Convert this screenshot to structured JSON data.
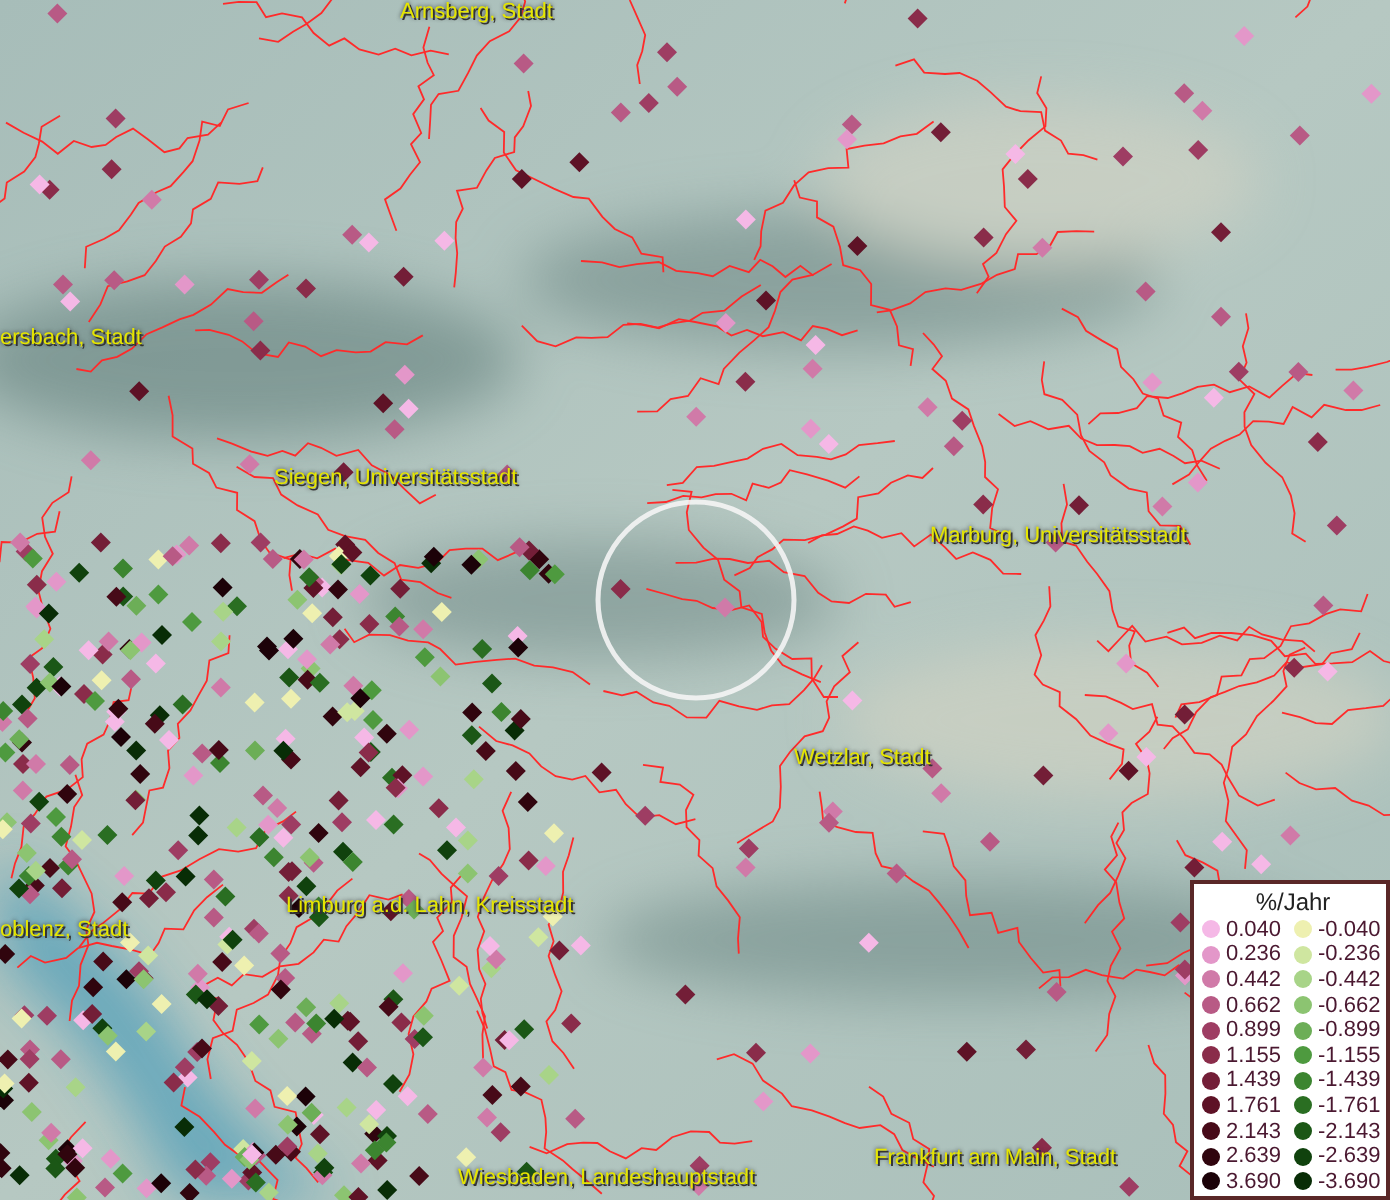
{
  "map": {
    "place_labels": [
      {
        "text": "Arnsberg, Stadt"
      },
      {
        "text": "ersbach, Stadt"
      },
      {
        "text": "Siegen, Universitätsstadt"
      },
      {
        "text": "Marburg, Universitätsstadt"
      },
      {
        "text": "Wetzlar, Stadt"
      },
      {
        "text": "Limburg a.d. Lahn, Kreisstadt"
      },
      {
        "text": "oblenz, Stadt"
      },
      {
        "text": "Frankfurt am Main, Stadt"
      },
      {
        "text": "Wiesbaden, Landeshauptstadt"
      }
    ]
  },
  "legend": {
    "title": "%/Jahr",
    "rows": [
      {
        "positive": {
          "value": "0.040",
          "color": "#f5b8e6"
        },
        "negative": {
          "value": "-0.040",
          "color": "#eef0b0"
        }
      },
      {
        "positive": {
          "value": "0.236",
          "color": "#e397c9"
        },
        "negative": {
          "value": "-0.236",
          "color": "#cfe6a0"
        }
      },
      {
        "positive": {
          "value": "0.442",
          "color": "#d07aa8"
        },
        "negative": {
          "value": "-0.442",
          "color": "#a8d488"
        }
      },
      {
        "positive": {
          "value": "0.662",
          "color": "#b85a85"
        },
        "negative": {
          "value": "-0.662",
          "color": "#8cc471"
        }
      },
      {
        "positive": {
          "value": "0.899",
          "color": "#9e3d63"
        },
        "negative": {
          "value": "-0.899",
          "color": "#6cae57"
        }
      },
      {
        "positive": {
          "value": "1.155",
          "color": "#8a2c4a"
        },
        "negative": {
          "value": "-1.155",
          "color": "#4e9a3f"
        }
      },
      {
        "positive": {
          "value": "1.439",
          "color": "#731e37"
        },
        "negative": {
          "value": "-1.439",
          "color": "#3c8530"
        }
      },
      {
        "positive": {
          "value": "1.761",
          "color": "#5e1226"
        },
        "negative": {
          "value": "-1.761",
          "color": "#2a6e22"
        }
      },
      {
        "positive": {
          "value": "2.143",
          "color": "#470a18"
        },
        "negative": {
          "value": "-2.143",
          "color": "#1b5716"
        }
      },
      {
        "positive": {
          "value": "2.639",
          "color": "#30050e"
        },
        "negative": {
          "value": "-2.639",
          "color": "#10420d"
        }
      },
      {
        "positive": {
          "value": "3.690",
          "color": "#1c0208"
        },
        "negative": {
          "value": "-3.690",
          "color": "#082d06"
        }
      }
    ]
  }
}
